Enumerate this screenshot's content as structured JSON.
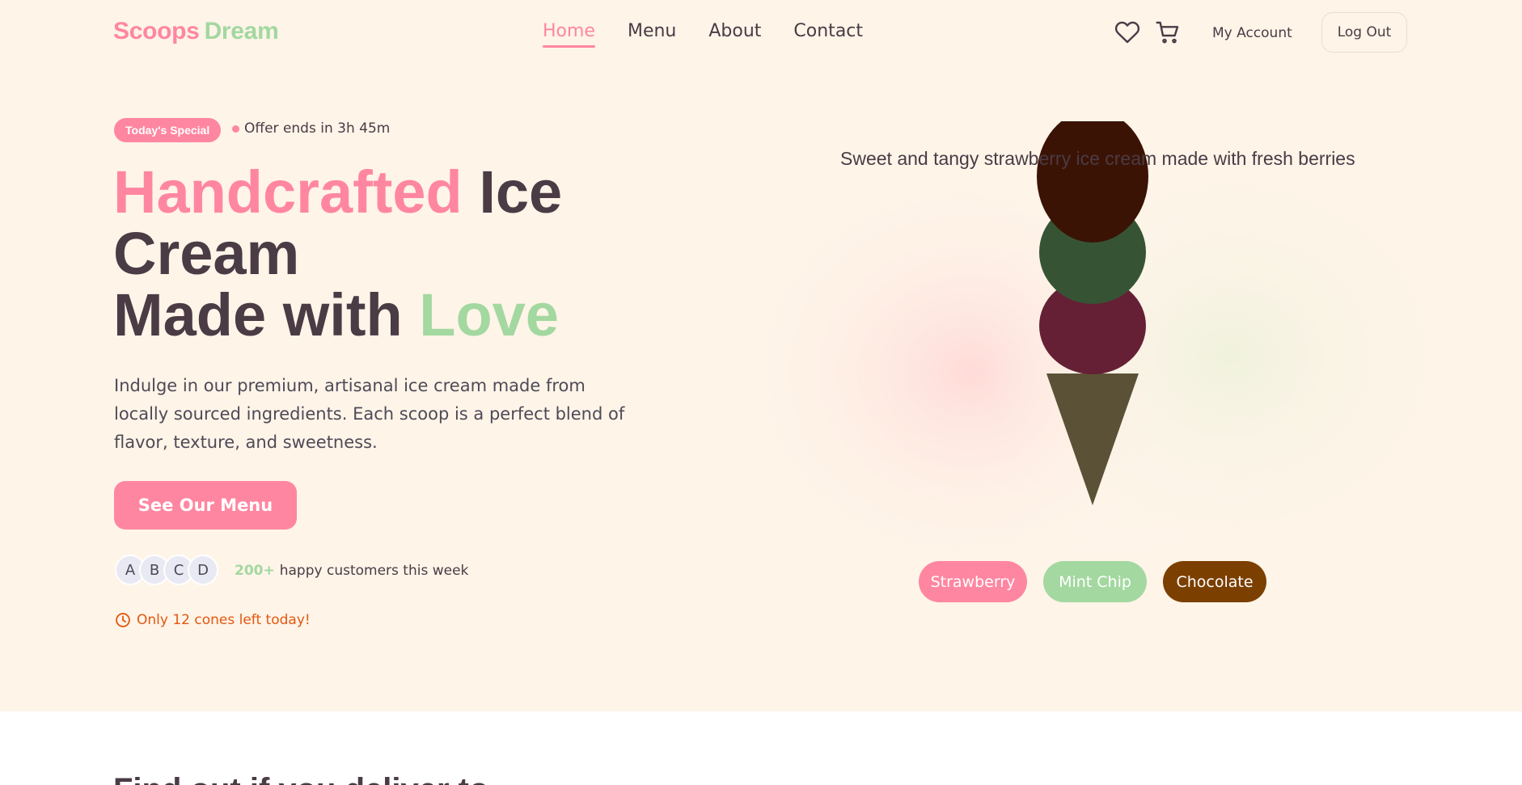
{
  "brand": {
    "part1": "Scoops",
    "part2": "Dream"
  },
  "nav": {
    "items": [
      {
        "label": "Home",
        "active": true
      },
      {
        "label": "Menu"
      },
      {
        "label": "About"
      },
      {
        "label": "Contact"
      }
    ]
  },
  "header": {
    "account_label": "My Account",
    "logout_label": "Log Out",
    "icons": [
      "heart-icon",
      "cart-icon"
    ]
  },
  "hero": {
    "badge": "Today's Special",
    "offer": "Offer ends in 3h 45m",
    "headline": {
      "word1": "Handcrafted",
      "word2": "Ice",
      "line2": "Cream",
      "line3a": "Made with",
      "line3b": "Love"
    },
    "description": "Indulge in our premium, artisanal ice cream made from locally sourced ingredients. Each scoop is a perfect blend of flavor, texture, and sweetness.",
    "cta_label": "See Our Menu",
    "avatars": [
      "A",
      "B",
      "C",
      "D"
    ],
    "customers_count": "200+",
    "customers_text": "happy customers this week",
    "stock_text": "Only 12 cones left today!",
    "flavor_description": "Sweet and tangy strawberry ice cream made with fresh berries",
    "flavors": [
      {
        "label": "Strawberry",
        "color": "#ff86a1"
      },
      {
        "label": "Mint Chip",
        "color": "#a3d8a0"
      },
      {
        "label": "Chocolate",
        "color": "#7b3f00"
      }
    ]
  },
  "colors": {
    "accent_pink": "#ff86a1",
    "accent_green": "#a3d8a0",
    "hero_bg": "#fef4e8",
    "text": "#4a3b45",
    "warning": "#e4570f",
    "scoop_top": "#3b1304",
    "scoop_mid": "#365434",
    "scoop_low": "#652035",
    "cone": "#5b5136"
  },
  "section_peek": "Find out if you deliver to"
}
